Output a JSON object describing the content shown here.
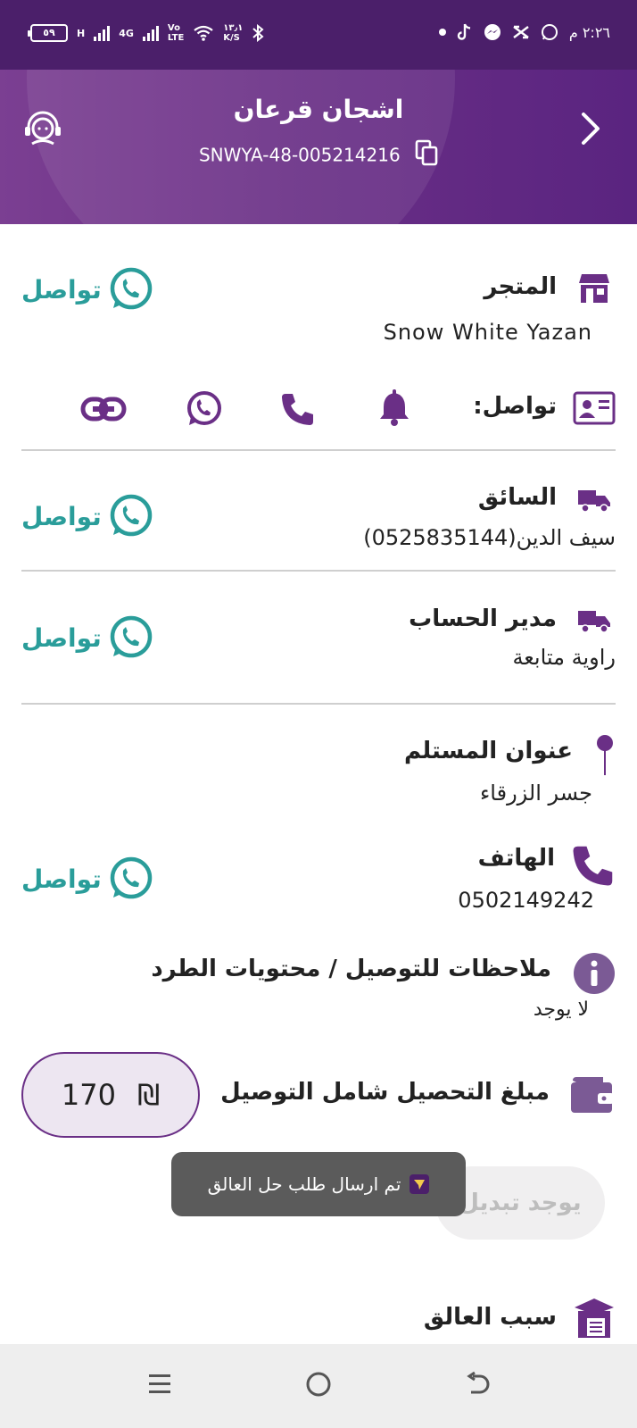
{
  "status_bar": {
    "time": "٢:٢٦ م",
    "battery": "٥٩",
    "network_h": "H",
    "network_4g": "4G",
    "volte": "Vo\nLTE",
    "speed": "١٣٫١\nK/S"
  },
  "header": {
    "title": "اشجان قرعان",
    "code": "SNWYA-48-005214216"
  },
  "store": {
    "title": "المتجر",
    "name": "Snow White Yazan",
    "contact_label": "تواصل",
    "contact_row_label": "تواصل:"
  },
  "driver": {
    "title": "السائق",
    "name": "سيف الدين(0525835144)",
    "contact_label": "تواصل"
  },
  "account_manager": {
    "title": "مدير الحساب",
    "name": "راوية متابعة",
    "contact_label": "تواصل"
  },
  "recipient": {
    "title": "عنوان المستلم",
    "address": "جسر الزرقاء"
  },
  "phone": {
    "title": "الهاتف",
    "number": "0502149242",
    "contact_label": "تواصل"
  },
  "notes": {
    "title": "ملاحظات للتوصيل / محتويات الطرد",
    "value": "لا يوجد"
  },
  "collection": {
    "title": "مبلغ التحصيل شامل التوصيل",
    "amount": "170",
    "currency": "₪"
  },
  "swap_button": "يوجد تبديل",
  "toast": "تم ارسال طلب حل العالق",
  "stuck_reason": {
    "title": "سبب العالق"
  },
  "colors": {
    "primary": "#6a2f86",
    "accent": "#2a9d9a"
  }
}
